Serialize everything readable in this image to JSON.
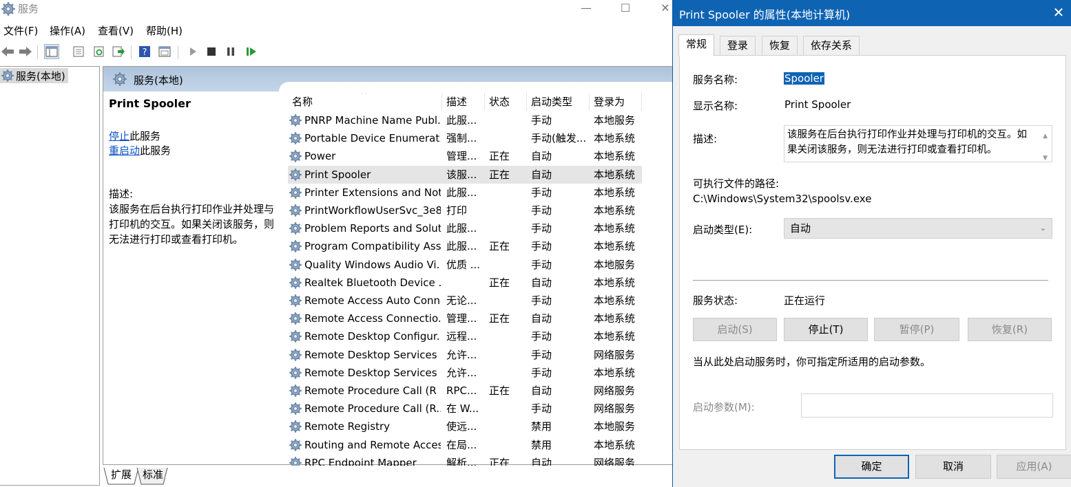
{
  "window": {
    "title": "服务",
    "minimize": "—",
    "maximize": "☐",
    "close": "✕"
  },
  "menu": [
    "文件(F)",
    "操作(A)",
    "查看(V)",
    "帮助(H)"
  ],
  "toolbar_icons": [
    "back-arrow-icon",
    "forward-arrow-icon",
    "show-hide-tree-icon",
    "properties-icon",
    "refresh-icon",
    "export-list-icon",
    "help-icon",
    "console-view-icon",
    "start-service-icon",
    "stop-service-icon",
    "pause-service-icon",
    "restart-service-icon"
  ],
  "tree": {
    "root_label": "服务(本地)"
  },
  "pane": {
    "header_title": "服务(本地)",
    "selected_title": "Print Spooler",
    "stop_link": "停止",
    "stop_suffix": "此服务",
    "restart_link": "重启动",
    "restart_suffix": "此服务",
    "desc_label": "描述:",
    "desc_text": "该服务在后台执行打印作业并处理与打印机的交互。如果关闭该服务，则无法进行打印或查看打印机。"
  },
  "columns": [
    "名称",
    "描述",
    "状态",
    "启动类型",
    "登录为"
  ],
  "services": [
    [
      "PNRP Machine Name Publ...",
      "此服...",
      "",
      "手动",
      "本地服务"
    ],
    [
      "Portable Device Enumerat...",
      "强制...",
      "",
      "手动(触发...",
      "本地系统"
    ],
    [
      "Power",
      "管理...",
      "正在",
      "自动",
      "本地系统"
    ],
    [
      "Print Spooler",
      "该服...",
      "正在",
      "自动",
      "本地系统"
    ],
    [
      "Printer Extensions and Noti...",
      "此服...",
      "",
      "手动",
      "本地系统"
    ],
    [
      "PrintWorkflowUserSvc_3e8",
      "打印",
      "",
      "手动",
      "本地系统"
    ],
    [
      "Problem Reports and Solut...",
      "此服...",
      "",
      "手动",
      "本地系统"
    ],
    [
      "Program Compatibility Assi...",
      "此服...",
      "正在",
      "手动",
      "本地系统"
    ],
    [
      "Quality Windows Audio Vi...",
      "优质 ...",
      "",
      "手动",
      "本地服务"
    ],
    [
      "Realtek Bluetooth Device ...",
      "",
      "正在",
      "自动",
      "本地系统"
    ],
    [
      "Remote Access Auto Conn...",
      "无论...",
      "",
      "手动",
      "本地系统"
    ],
    [
      "Remote Access Connectio...",
      "管理...",
      "正在",
      "自动",
      "本地系统"
    ],
    [
      "Remote Desktop Configur...",
      "远程...",
      "",
      "手动",
      "本地系统"
    ],
    [
      "Remote Desktop Services",
      "允许...",
      "",
      "手动",
      "网络服务"
    ],
    [
      "Remote Desktop Services ...",
      "允许...",
      "",
      "手动",
      "本地系统"
    ],
    [
      "Remote Procedure Call (R",
      "RPC...",
      "正在",
      "自动",
      "网络服务"
    ],
    [
      "Remote Procedure Call (R...",
      "在 W...",
      "",
      "手动",
      "网络服务"
    ],
    [
      "Remote Registry",
      "使远...",
      "",
      "禁用",
      "本地服务"
    ],
    [
      "Routing and Remote Access",
      "在局...",
      "",
      "禁用",
      "本地系统"
    ],
    [
      "RPC Endpoint Mapper",
      "解析...",
      "正在",
      "自动",
      "网络服务"
    ]
  ],
  "selected_row": 3,
  "bottom_tabs": [
    "扩展",
    "标准"
  ],
  "dialog": {
    "title": "Print Spooler 的属性(本地计算机)",
    "close": "✕",
    "tabs": [
      "常规",
      "登录",
      "恢复",
      "依存关系"
    ],
    "service_name_label": "服务名称:",
    "service_name": "Spooler",
    "display_name_label": "显示名称:",
    "display_name": "Print Spooler",
    "description_label": "描述:",
    "description": "该服务在后台执行打印作业并处理与打印机的交互。如果关闭该服务，则无法进行打印或查看打印机。",
    "path_label": "可执行文件的路径:",
    "path": "C:\\Windows\\System32\\spoolsv.exe",
    "startup_type_label": "启动类型(E):",
    "startup_type": "自动",
    "status_label": "服务状态:",
    "status": "正在运行",
    "btn_start": "启动(S)",
    "btn_stop": "停止(T)",
    "btn_pause": "暂停(P)",
    "btn_resume": "恢复(R)",
    "hint": "当从此处启动服务时，你可指定所适用的启动参数。",
    "param_label": "启动参数(M):",
    "param_value": "",
    "btn_ok": "确定",
    "btn_cancel": "取消",
    "btn_apply": "应用(A)"
  },
  "colors": {
    "accent": "#0e63b3",
    "pane_header": "#b8cde3",
    "link": "#0a50c8",
    "selected_row": "#e5e5e5"
  }
}
